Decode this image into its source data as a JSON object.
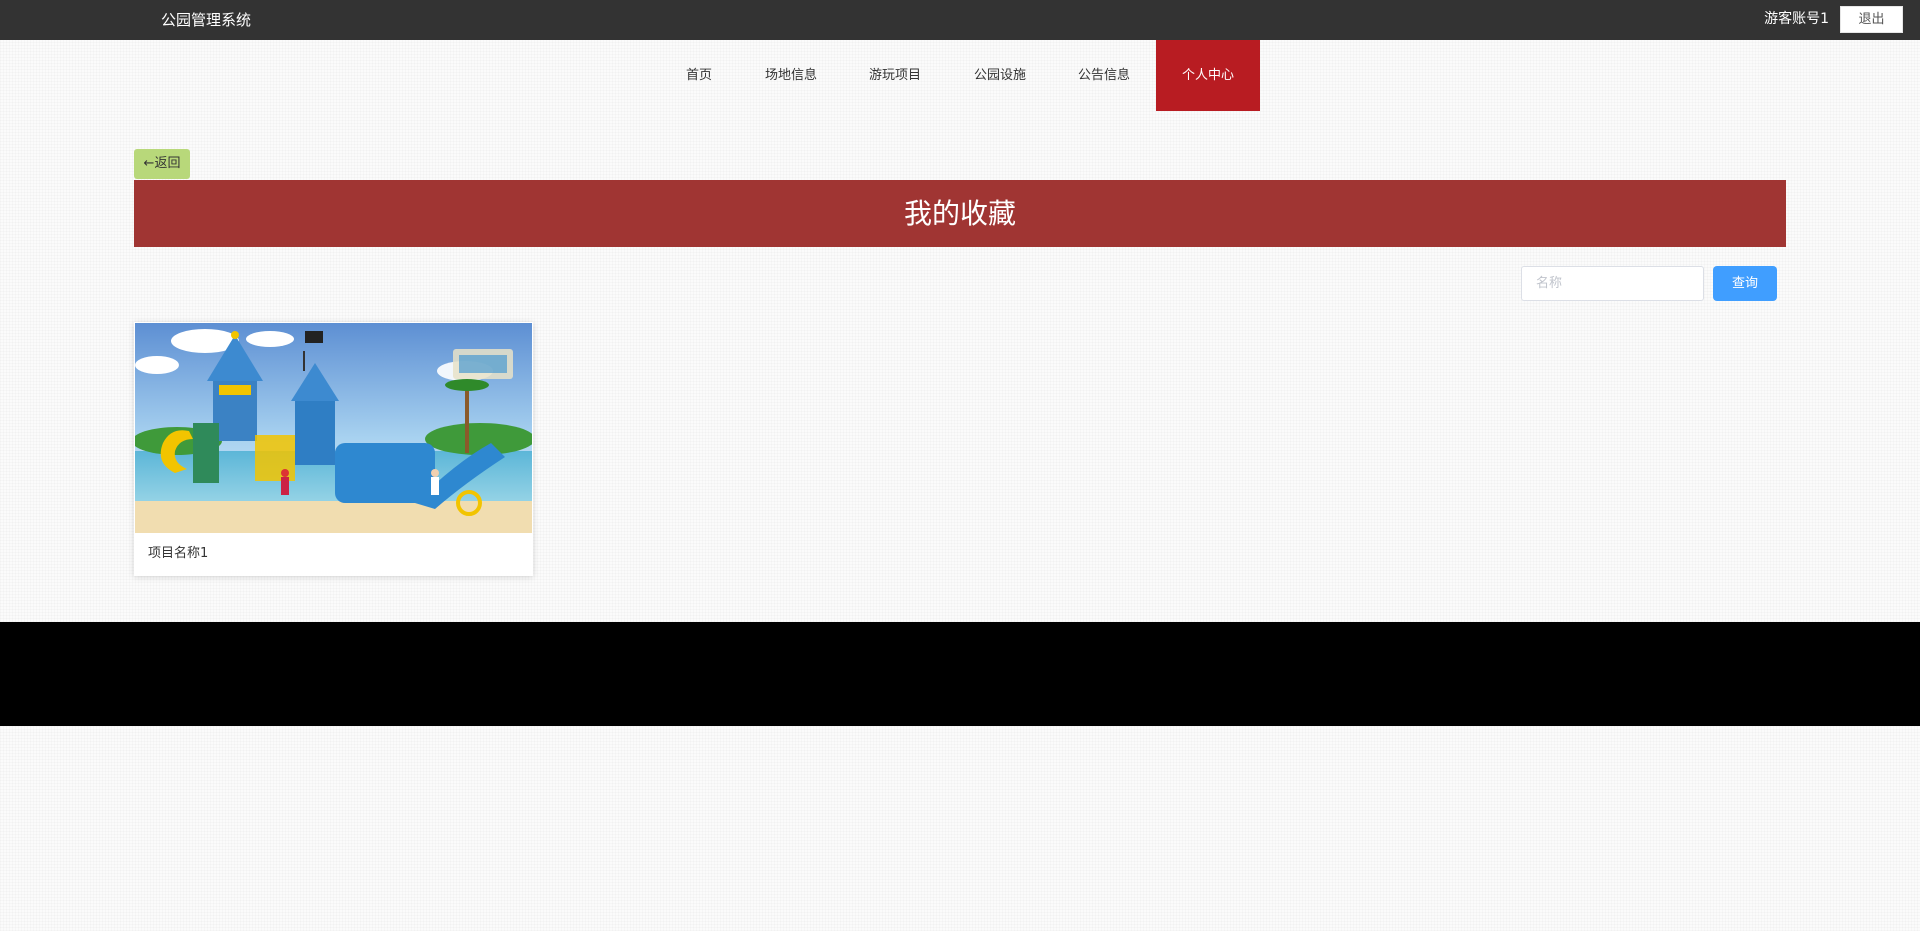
{
  "header": {
    "brand": "公园管理系统",
    "user": "游客账号1",
    "logout_label": "退出"
  },
  "nav": {
    "items": [
      {
        "label": "首页"
      },
      {
        "label": "场地信息"
      },
      {
        "label": "游玩项目"
      },
      {
        "label": "公园设施"
      },
      {
        "label": "公告信息"
      },
      {
        "label": "个人中心",
        "active": true
      }
    ]
  },
  "page": {
    "back_label": "←返回",
    "title": "我的收藏"
  },
  "search": {
    "placeholder": "名称",
    "button_label": "查询"
  },
  "favorites": [
    {
      "title": "项目名称1",
      "image": "playground-castle-slide-image"
    }
  ],
  "colors": {
    "topbar": "#333333",
    "nav_active": "#b81c22",
    "title_bar": "#a03533",
    "back_button": "#b8d87a",
    "search_button": "#409eff",
    "footer": "#000000"
  }
}
